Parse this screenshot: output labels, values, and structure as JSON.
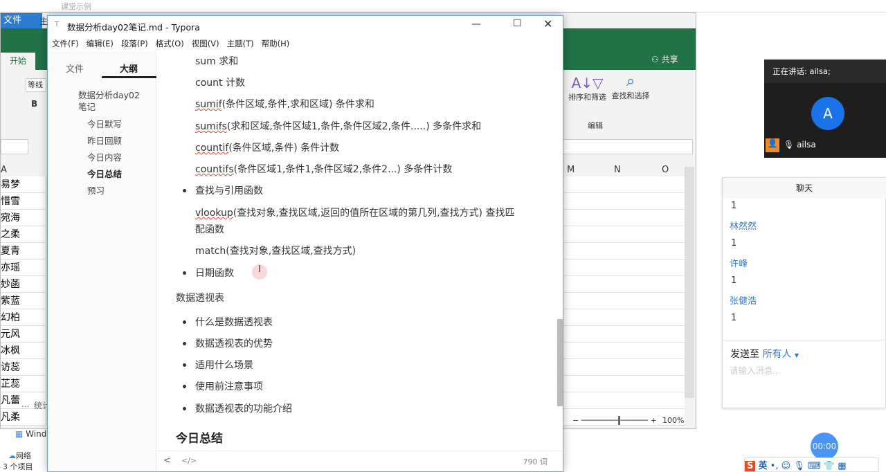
{
  "explorer": {
    "toolbar_title": "课堂示例",
    "nav_item_windows": "Wind",
    "nav_item_network": "网络",
    "status": "3 个项目"
  },
  "excel": {
    "tab_file": "文件",
    "tab_home": "开始",
    "tab_partial": "主",
    "font_name": "等线",
    "bold": "B",
    "share": "共享",
    "sort_filter": "排序和筛选",
    "find_select": "查找和选择",
    "group_editing": "编辑",
    "col_a": "A",
    "col_m": "M",
    "col_n": "N",
    "col_o": "O",
    "names": [
      "易梦",
      "惜雪",
      "宛海",
      "之柔",
      "夏青",
      "亦瑶",
      "妙菡",
      "紫蓝",
      "幻柏",
      "元风",
      "冰枫",
      "访蕊",
      "芷蕊",
      "凡蕾",
      "凡柔"
    ],
    "sheet_more": "...",
    "sheet_tab_partial": "统计",
    "zoom": "100%",
    "zoom_level_percent": 100,
    "accent": "#217346"
  },
  "typora": {
    "title": "数据分析day02笔记.md - Typora",
    "menu": [
      "文件(F)",
      "编辑(E)",
      "段落(P)",
      "格式(O)",
      "视图(V)",
      "主题(T)",
      "帮助(H)"
    ],
    "sidebar_tabs": [
      "文件",
      "大纲"
    ],
    "outline": [
      "数据分析day02笔记",
      "今日默写",
      "昨日回顾",
      "今日内容",
      "今日总结",
      "预习"
    ],
    "content": {
      "sum": "sum 求和",
      "count": "count 计数",
      "sumif_fn": "sumif",
      "sumif_rest": "(条件区域,条件,求和区域) 条件求和",
      "sumifs_fn": "sumifs",
      "sumifs_rest": "(求和区域,条件区域1,条件,条件区域2,条件.....) 多条件求和",
      "countif_fn": "countif",
      "countif_rest": "(条件区域,条件)  条件计数",
      "countifs_fn": "countifs",
      "countifs_rest": "(条件区域1,条件1,条件区域2,条件2...) 多条件计数",
      "lookup_bullet": "查找与引用函数",
      "vlookup_fn": "vlookup",
      "vlookup_rest": "(查找对象,查找区域,返回的值所在区域的第几列,查找方式) 查找匹",
      "vlookup_wrap": "配函数",
      "match": "match(查找对象,查找区域,查找方式)",
      "date_bullet": "日期函数",
      "pivot_heading": "数据透视表",
      "pivot_items": [
        "什么是数据透视表",
        "数据透视表的优势",
        "适用什么场景",
        "使用前注意事项",
        "数据透视表的功能介绍"
      ],
      "summary_heading": "今日总结"
    },
    "word_count": "790 词"
  },
  "meeting": {
    "speaking": "正在讲话: ailsa;",
    "avatar_letter": "A",
    "participant": "ailsa",
    "timer": "00:00",
    "chat_title": "聊天",
    "messages": [
      {
        "text": "1"
      },
      {
        "sender": "林然然",
        "text": "1"
      },
      {
        "sender": "许峰",
        "text": "1"
      },
      {
        "sender": "张健浩",
        "text": "1"
      }
    ],
    "send_to_label": "发送至",
    "send_to_target": "所有人",
    "input_placeholder": "请输入消息..."
  },
  "ime": {
    "mode": "英"
  }
}
